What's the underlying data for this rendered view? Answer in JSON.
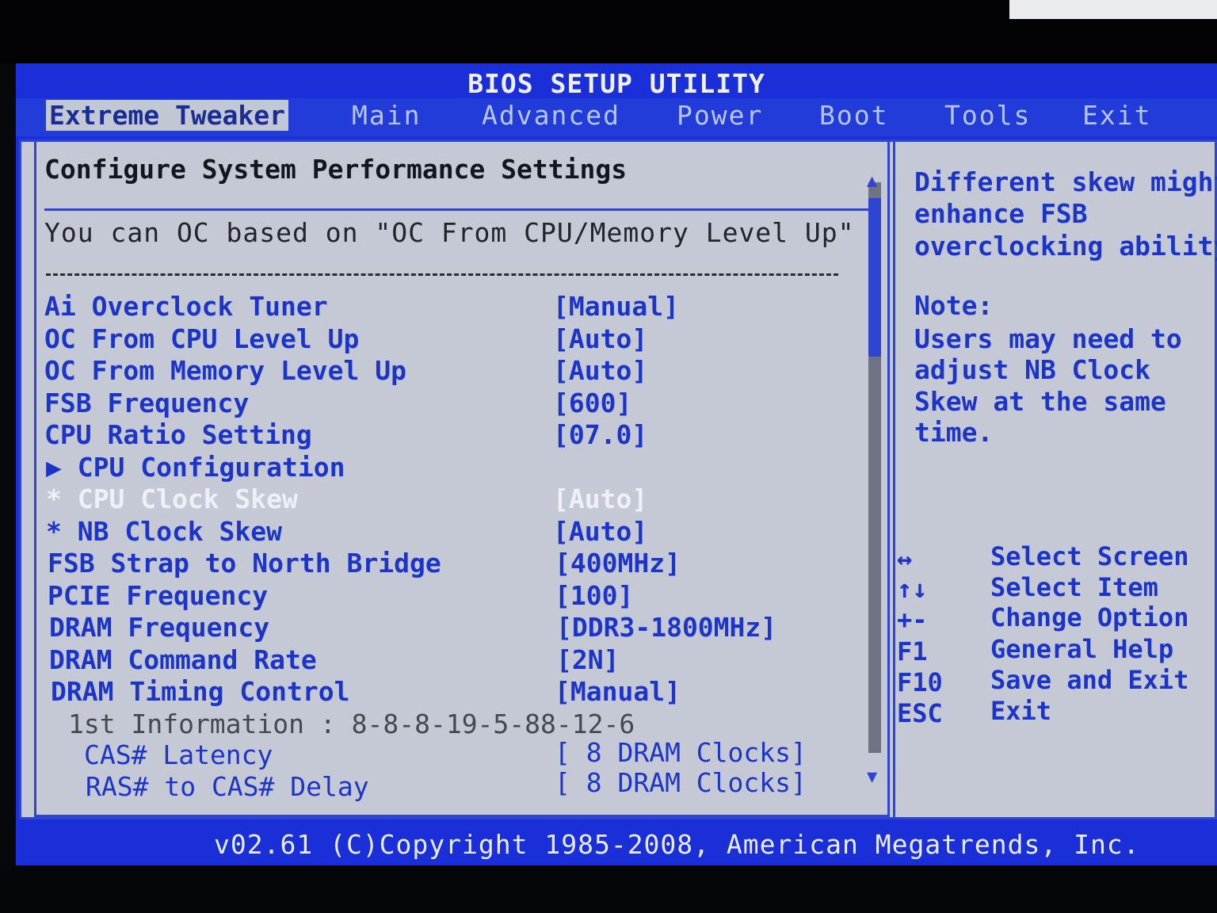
{
  "bios": {
    "title": "BIOS SETUP UTILITY",
    "tabs": [
      {
        "label": "Extreme Tweaker",
        "active": true
      },
      {
        "label": "Main"
      },
      {
        "label": "Advanced"
      },
      {
        "label": "Power"
      },
      {
        "label": "Boot"
      },
      {
        "label": "Tools"
      },
      {
        "label": "Exit"
      }
    ],
    "heading": "Configure System Performance Settings",
    "info": "You can OC based on \"OC From CPU/Memory Level Up\"",
    "settings": [
      {
        "label": "Ai Overclock Tuner",
        "value": "[Manual]"
      },
      {
        "label": "OC From CPU Level Up",
        "value": "[Auto]"
      },
      {
        "label": "OC From Memory Level Up",
        "value": "[Auto]"
      },
      {
        "label": "FSB Frequency",
        "value": "[600]"
      },
      {
        "label": "CPU Ratio Setting",
        "value": "[07.0]"
      },
      {
        "label": "▶ CPU Configuration",
        "value": ""
      },
      {
        "label": "* CPU Clock Skew",
        "value": "[Auto]"
      },
      {
        "label": "* NB Clock Skew",
        "value": "[Auto]"
      },
      {
        "label": "FSB Strap to North Bridge",
        "value": "[400MHz]"
      },
      {
        "label": "PCIE Frequency",
        "value": "[100]"
      },
      {
        "label": "DRAM Frequency",
        "value": "[DDR3-1800MHz]"
      },
      {
        "label": "DRAM Command Rate",
        "value": "[2N]"
      },
      {
        "label": "DRAM Timing Control",
        "value": "[Manual]"
      },
      {
        "label": "1st Information : 8-8-8-19-5-88-12-6",
        "value": ""
      },
      {
        "label": "CAS# Latency",
        "value": "[ 8 DRAM Clocks]"
      },
      {
        "label": "RAS# to CAS# Delay",
        "value": "[ 8 DRAM Clocks]"
      }
    ],
    "help": [
      "Different skew might",
      "enhance FSB",
      "overclocking ability",
      "",
      "Note:",
      "Users may need to",
      "adjust NB Clock",
      "Skew at the same",
      "time."
    ],
    "keys": [
      {
        "key": "↔",
        "desc": "Select Screen"
      },
      {
        "key": "↑↓",
        "desc": "Select Item"
      },
      {
        "key": "+-",
        "desc": "Change Option"
      },
      {
        "key": "F1",
        "desc": "General Help"
      },
      {
        "key": "F10",
        "desc": "Save and Exit"
      },
      {
        "key": "ESC",
        "desc": "Exit"
      }
    ],
    "copyright": "v02.61 (C)Copyright 1985-2008, American Megatrends, Inc."
  },
  "colors": {
    "background": "#c5c9d5",
    "accent_blue": "#1c35c8",
    "selected_text": "#eef0f6"
  }
}
